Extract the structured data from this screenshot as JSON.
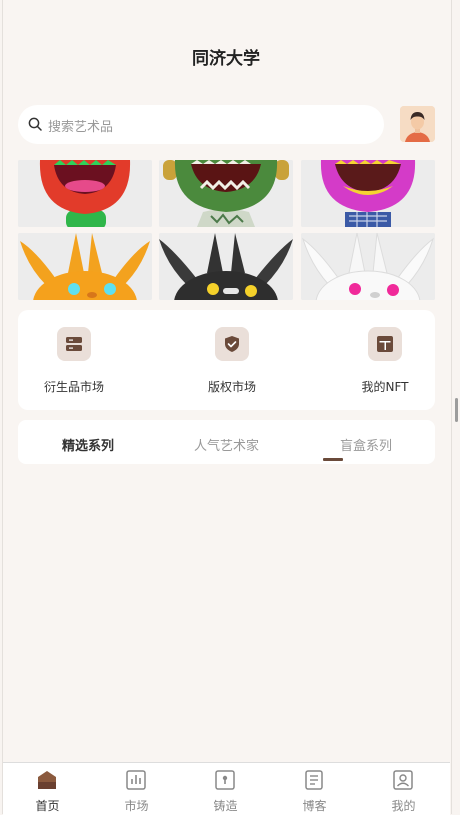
{
  "header": {
    "title": "同济大学"
  },
  "search": {
    "placeholder": "搜索艺术品"
  },
  "gallery": {
    "items": [
      {
        "name": "red-monster-figure"
      },
      {
        "name": "green-monster-figure"
      },
      {
        "name": "magenta-monster-figure"
      },
      {
        "name": "orange-rabbit-figure"
      },
      {
        "name": "black-rabbit-figure"
      },
      {
        "name": "white-rabbit-figure"
      }
    ]
  },
  "quick_links": [
    {
      "label": "衍生品市场",
      "icon": "server-icon"
    },
    {
      "label": "版权市场",
      "icon": "shield-check-icon"
    },
    {
      "label": "我的NFT",
      "icon": "layout-icon"
    }
  ],
  "tabs": [
    {
      "label": "精选系列",
      "active": true
    },
    {
      "label": "人气艺术家",
      "active": false
    },
    {
      "label": "盲盒系列",
      "active": false
    }
  ],
  "bottom_nav": [
    {
      "label": "首页",
      "icon": "home-icon",
      "active": true
    },
    {
      "label": "市场",
      "icon": "chart-icon",
      "active": false
    },
    {
      "label": "铸造",
      "icon": "mint-icon",
      "active": false
    },
    {
      "label": "博客",
      "icon": "document-icon",
      "active": false
    },
    {
      "label": "我的",
      "icon": "profile-icon",
      "active": false
    }
  ],
  "colors": {
    "accent": "#6a4a3a",
    "background": "#f9f5f2",
    "icon_bg": "#eadfd9"
  }
}
